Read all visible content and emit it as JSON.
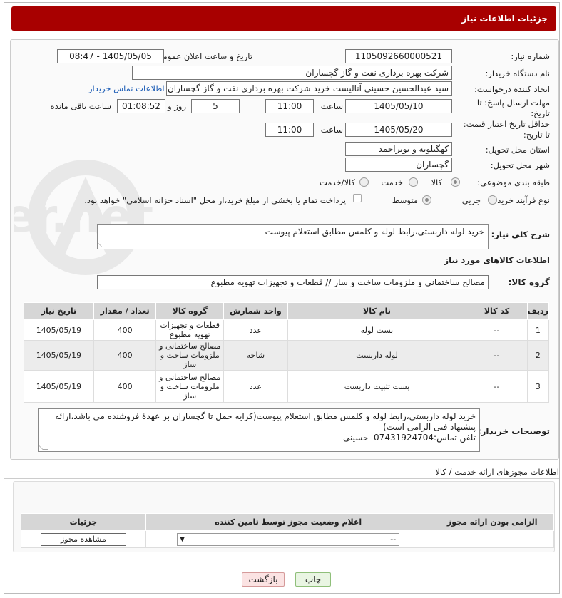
{
  "header": {
    "title": "جزئیات اطلاعات نیاز"
  },
  "form": {
    "need_number_label": "شماره نیاز:",
    "need_number": "1105092660000521",
    "announce_label": "تاریخ و ساعت اعلان عمومی:",
    "announce_value": "1405/05/05 - 08:47",
    "buyer_org_label": "نام دستگاه خریدار:",
    "buyer_org": "شرکت بهره برداری نفت و گاز گچساران",
    "creator_label": "ایجاد کننده درخواست:",
    "creator": "سید عبدالحسین حسینی آنالیست خرید شرکت بهره برداری نفت و گاز گچساران",
    "buyer_contact_link": "اطلاعات تماس خریدار",
    "reply_deadline_label": "مهلت ارسال پاسخ: تا تاریخ:",
    "reply_date": "1405/05/10",
    "time_label": "ساعت",
    "reply_time": "11:00",
    "days": "5",
    "days_label": "روز و",
    "remaining_time": "01:08:52",
    "remaining_label": "ساعت باقی مانده",
    "price_validity_label": "حداقل تاریخ اعتبار قیمت: تا تاریخ:",
    "price_date": "1405/05/20",
    "price_time": "11:00",
    "province_label": "استان محل تحویل:",
    "province": "کهگیلویه و بویراحمد",
    "city_label": "شهر محل تحویل:",
    "city": "گچساران",
    "category_label": "طبقه بندی موضوعی:",
    "category_options": [
      "کالا",
      "خدمت",
      "کالا/خدمت"
    ],
    "process_label": "نوع فرآیند خرید :",
    "process_options": [
      "جزیی",
      "متوسط"
    ],
    "payment_note": "پرداخت تمام یا بخشی از مبلغ خرید،از محل \"اسناد خزانه اسلامی\" خواهد بود."
  },
  "summary": {
    "label": "شرح کلی نیاز:",
    "text": "خرید لوله داربستی،رابط لوله و کلمس مطابق استعلام پیوست"
  },
  "goods_info": {
    "title": "اطلاعات کالاهای مورد نیاز",
    "group_label": "گروه کالا:",
    "group_value": "مصالح ساختمانی و ملزومات ساخت و ساز //  قطعات و تجهیزات تهویه مطبوع"
  },
  "items_table": {
    "headers": [
      "ردیف",
      "کد کالا",
      "نام کالا",
      "واحد شمارش",
      "گروه کالا",
      "تعداد / مقدار",
      "تاریخ نیاز"
    ],
    "rows": [
      {
        "idx": "1",
        "code": "--",
        "name": "بست لوله",
        "unit": "عدد",
        "group": "قطعات و تجهیزات تهویه مطبوع",
        "qty": "400",
        "date": "1405/05/19"
      },
      {
        "idx": "2",
        "code": "--",
        "name": "لوله داربست",
        "unit": "شاخه",
        "group": "مصالح ساختمانی و ملزومات ساخت و ساز",
        "qty": "400",
        "date": "1405/05/19"
      },
      {
        "idx": "3",
        "code": "--",
        "name": "بست تثبیت داربست",
        "unit": "عدد",
        "group": "مصالح ساختمانی و ملزومات ساخت و ساز",
        "qty": "400",
        "date": "1405/05/19"
      }
    ]
  },
  "buyer_notes": {
    "label": "توضیحات خریدار:",
    "text": "خرید لوله داربستی،رابط لوله و کلمس مطابق استعلام پیوست(کرایه حمل تا گچساران بر عهدۀ فروشنده می باشد،ارائه پیشنهاد فنی الزامی است)\nتلفن تماس:07431924704  حسینی"
  },
  "license": {
    "section_title": "اطلاعات مجوزهای ارائه خدمت / کالا",
    "headers": [
      "الزامی بودن ارائه مجوز",
      "اعلام وضعیت مجوز توسط تامین کننده",
      "جزئیات"
    ],
    "select_value": "--",
    "view_button": "مشاهده مجوز"
  },
  "buttons": {
    "print": "چاپ",
    "back": "بازگشت"
  },
  "watermark": "AriaTender.net"
}
